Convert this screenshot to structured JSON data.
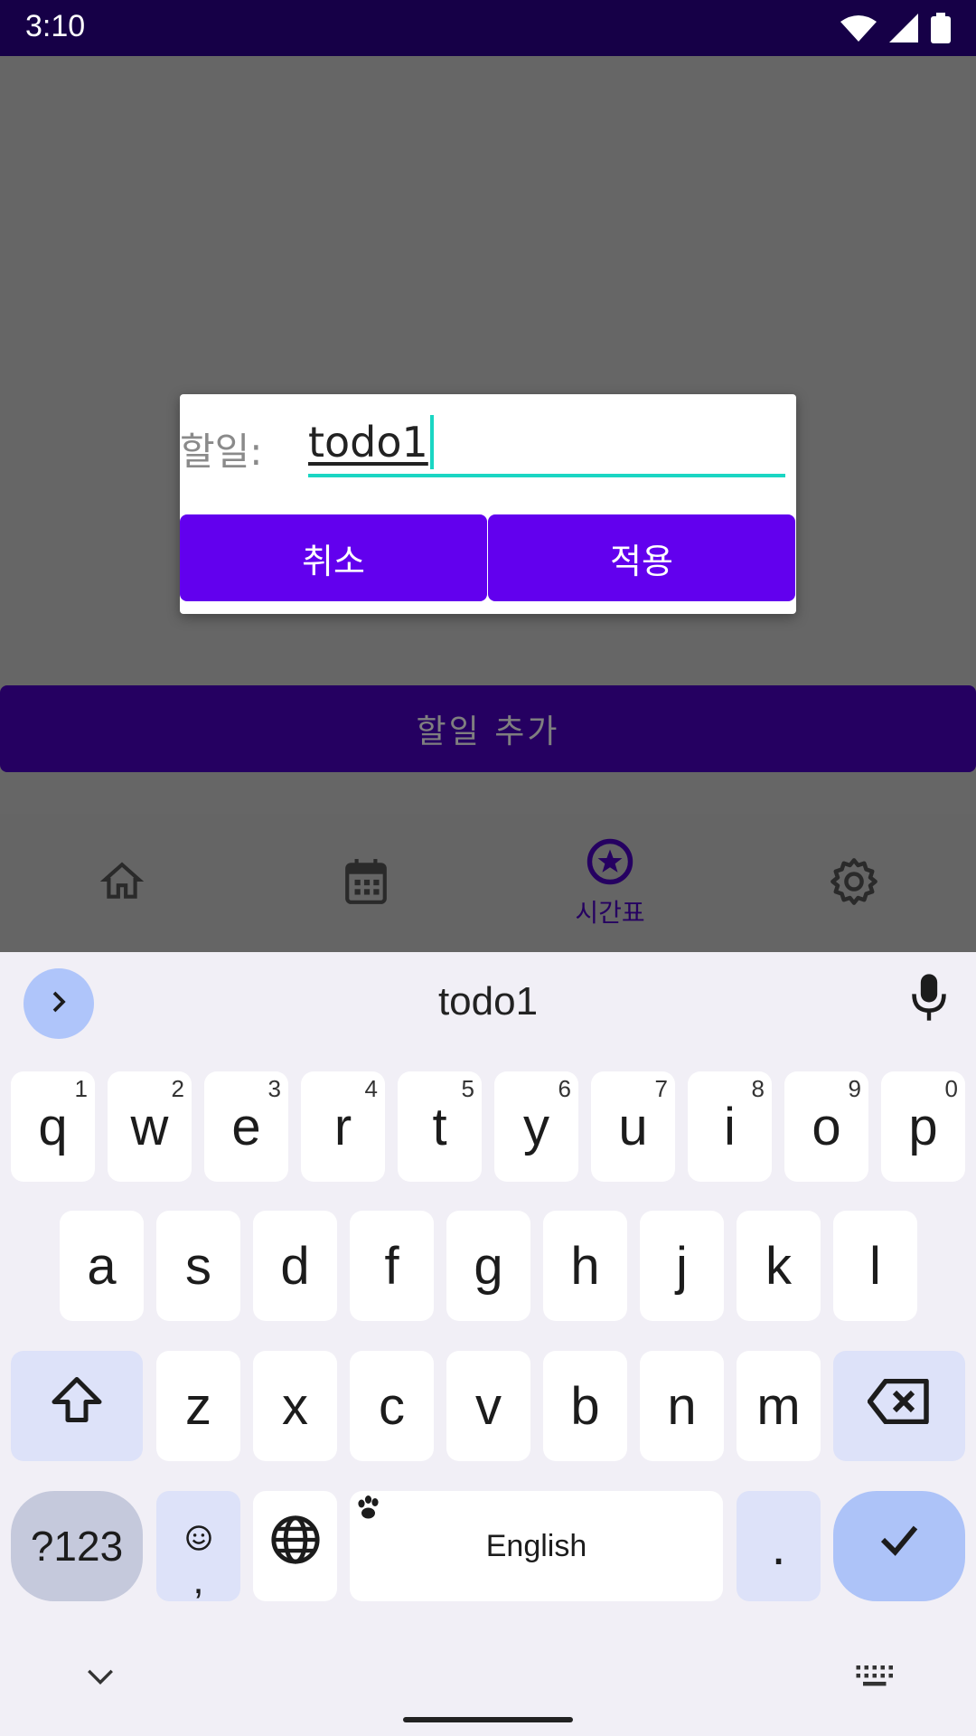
{
  "status_bar": {
    "time": "3:10"
  },
  "app": {
    "add_todo_label": "할일 추가"
  },
  "bottom_nav": {
    "items": [
      {
        "icon": "home-icon",
        "label": ""
      },
      {
        "icon": "calendar-icon",
        "label": ""
      },
      {
        "icon": "star-circle-icon",
        "label": "시간표"
      },
      {
        "icon": "gear-icon",
        "label": ""
      }
    ]
  },
  "dialog": {
    "label": "할일:",
    "input_value": "todo1",
    "cancel_label": "취소",
    "apply_label": "적용"
  },
  "keyboard": {
    "suggestion": "todo1",
    "row1": [
      {
        "key": "q",
        "hint": "1"
      },
      {
        "key": "w",
        "hint": "2"
      },
      {
        "key": "e",
        "hint": "3"
      },
      {
        "key": "r",
        "hint": "4"
      },
      {
        "key": "t",
        "hint": "5"
      },
      {
        "key": "y",
        "hint": "6"
      },
      {
        "key": "u",
        "hint": "7"
      },
      {
        "key": "i",
        "hint": "8"
      },
      {
        "key": "o",
        "hint": "9"
      },
      {
        "key": "p",
        "hint": "0"
      }
    ],
    "row2": [
      "a",
      "s",
      "d",
      "f",
      "g",
      "h",
      "j",
      "k",
      "l"
    ],
    "row3": [
      "z",
      "x",
      "c",
      "v",
      "b",
      "n",
      "m"
    ],
    "symbols_label": "?123",
    "emoji_comma": ",",
    "space_label": "English",
    "period_label": ".",
    "colors": {
      "accent": "#6200ee",
      "enter": "#adc3f8",
      "modifier": "#dde2f9"
    }
  }
}
